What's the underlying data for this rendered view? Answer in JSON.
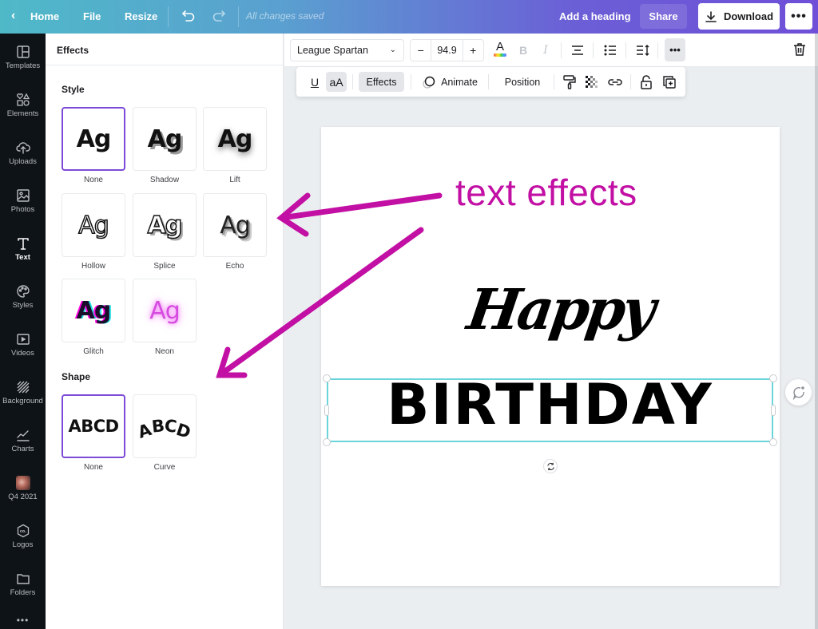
{
  "topbar": {
    "home": "Home",
    "file": "File",
    "resize": "Resize",
    "save_status": "All changes saved",
    "heading_name": "Add a heading",
    "share": "Share",
    "download": "Download",
    "more": "•••"
  },
  "sidebar": {
    "items": [
      {
        "label": "Templates",
        "icon": "templates-icon"
      },
      {
        "label": "Elements",
        "icon": "elements-icon"
      },
      {
        "label": "Uploads",
        "icon": "uploads-icon"
      },
      {
        "label": "Photos",
        "icon": "photos-icon"
      },
      {
        "label": "Text",
        "icon": "text-icon",
        "active": true
      },
      {
        "label": "Styles",
        "icon": "styles-icon"
      },
      {
        "label": "Videos",
        "icon": "videos-icon"
      },
      {
        "label": "Background",
        "icon": "background-icon"
      },
      {
        "label": "Charts",
        "icon": "charts-icon"
      },
      {
        "label": "Q4 2021",
        "icon": "folder-thumbnail"
      },
      {
        "label": "Logos",
        "icon": "logos-icon"
      },
      {
        "label": "Folders",
        "icon": "folders-icon"
      }
    ],
    "more": "•••"
  },
  "panel": {
    "title": "Effects",
    "style_section": "Style",
    "style_preview_text": "Ag",
    "styles": [
      {
        "label": "None",
        "selected": true
      },
      {
        "label": "Shadow"
      },
      {
        "label": "Lift"
      },
      {
        "label": "Hollow"
      },
      {
        "label": "Splice"
      },
      {
        "label": "Echo"
      },
      {
        "label": "Glitch"
      },
      {
        "label": "Neon"
      }
    ],
    "shape_section": "Shape",
    "shape_preview_text": "ABCD",
    "shapes": [
      {
        "label": "None",
        "selected": true
      },
      {
        "label": "Curve"
      }
    ]
  },
  "toolbar": {
    "font": "League Spartan",
    "font_size": "94.9",
    "minus": "−",
    "plus": "+",
    "bold": "B",
    "italic": "I",
    "color_letter": "A",
    "case_toggle": "aA",
    "underline": "U",
    "effects": "Effects",
    "animate": "Animate",
    "position": "Position",
    "more": "•••"
  },
  "canvas": {
    "line1": "Happy",
    "line2": "BIRTHDAY"
  },
  "annotation": {
    "text": "text effects",
    "color": "#c20fa4"
  },
  "colors": {
    "selection": "#7d4bd8",
    "selection_box": "#6ad4da",
    "sidebar_bg": "#0e1318"
  }
}
